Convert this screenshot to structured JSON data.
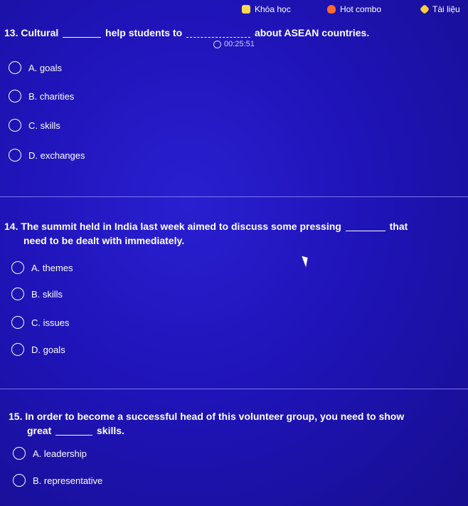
{
  "topbar": {
    "courses": "Khóa học",
    "hot_combo": "Hot combo",
    "documents": "Tài liệu"
  },
  "timer": "00:25:51",
  "questions": [
    {
      "number": "13.",
      "text_before": "Cultural",
      "text_after": "help students to",
      "text_end": "about ASEAN countries.",
      "options": [
        "A. goals",
        "B. charities",
        "C. skills",
        "D. exchanges"
      ]
    },
    {
      "number": "14.",
      "line1": "The summit held in India last week aimed to discuss some pressing",
      "line1_end": "that",
      "line2": "need to be dealt with immediately.",
      "options": [
        "A. themes",
        "B. skills",
        "C. issues",
        "D. goals"
      ]
    },
    {
      "number": "15.",
      "line1": "In order to become a successful head of this volunteer group, you need to show",
      "line2_before": "great",
      "line2_after": "skills.",
      "options": [
        "A. leadership",
        "B. representative"
      ]
    }
  ],
  "colors": {
    "background": "#1f14b8",
    "text": "#ffffff",
    "divider": "#8e8cff"
  }
}
